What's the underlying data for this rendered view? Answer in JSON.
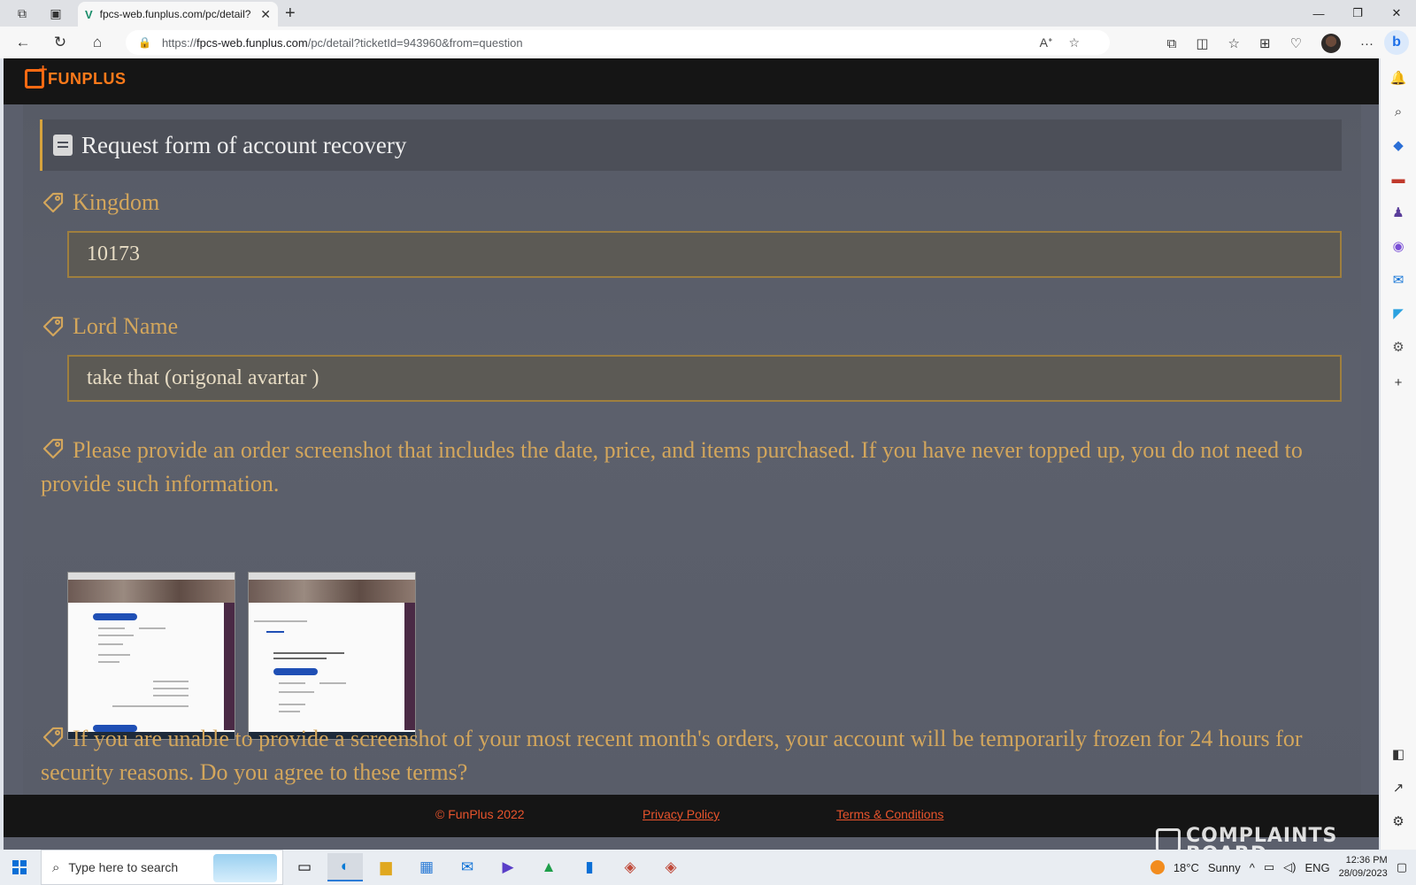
{
  "browser": {
    "tab_title": "fpcs-web.funplus.com/pc/detail?",
    "url_prefix": "https://",
    "url_host": "fpcs-web.funplus.com",
    "url_path": "/pc/detail?ticketId=943960&from=question",
    "icons": [
      "workspaces-icon",
      "tab-actions-icon",
      "back-icon",
      "refresh-icon",
      "home-icon",
      "lock-icon",
      "read-aloud-icon",
      "favorite-star-icon",
      "extensions-icon",
      "split-screen-icon",
      "favorites-icon",
      "collections-icon",
      "browser-essentials-icon",
      "profile-avatar",
      "more-icon",
      "bing-copilot-icon"
    ]
  },
  "site": {
    "brand": "FUNPLUS",
    "form_title": "Request form of account recovery",
    "fields": [
      {
        "label": "Kingdom",
        "value": "10173"
      },
      {
        "label": "Lord Name",
        "value": "take that (origonal avartar )"
      }
    ],
    "order_prompt": "Please provide an order screenshot that includes the date, price, and items purchased. If you have never topped up, you do not need to provide such information.",
    "freeze_prompt": "If you are unable to provide a screenshot of your most recent month's orders, your account will be temporarily frozen for 24 hours for security reasons. Do you agree to these terms?",
    "footer": {
      "copyright": "© FunPlus 2022",
      "privacy": "Privacy Policy",
      "terms": "Terms & Conditions"
    }
  },
  "taskbar": {
    "search_placeholder": "Type here to search",
    "weather_temp": "18°C",
    "weather_text": "Sunny",
    "language": "ENG",
    "time": "12:36 PM",
    "date": "28/09/2023"
  },
  "watermark": {
    "line1": "COMPLAINTS",
    "line2": "BOARD"
  },
  "colors": {
    "accent_gold": "#d3a65c",
    "footer_link": "#e8542c",
    "brand_orange": "#ff6a12"
  }
}
